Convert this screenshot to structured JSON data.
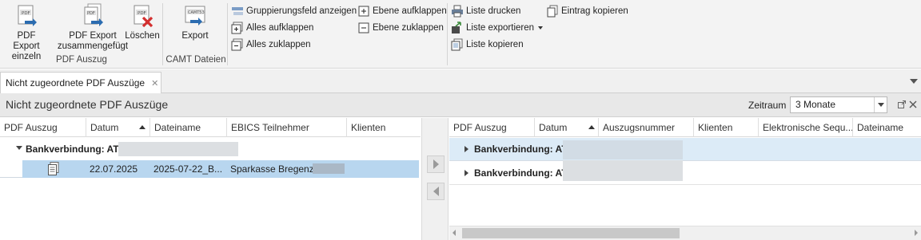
{
  "ribbon": {
    "pdf_export_einzeln": "PDF Export\neinzeln",
    "pdf_export_einzeln_l1": "PDF Export",
    "pdf_export_einzeln_l2": "einzeln",
    "pdf_export_zus_l1": "PDF Export",
    "pdf_export_zus_l2": "zusammengefügt",
    "loeschen": "Löschen",
    "group_pdf": "PDF Auszug",
    "export": "Export",
    "group_camt": "CAMT Dateien",
    "camt_icon_text": "CAMT53",
    "pdf_icon_text": "PDF",
    "gruppierungsfeld": "Gruppierungsfeld anzeigen",
    "alles_aufklappen": "Alles aufklappen",
    "alles_zuklappen": "Alles zuklappen",
    "ebene_aufklappen": "Ebene aufklappen",
    "ebene_zuklappen": "Ebene zuklappen",
    "liste_drucken": "Liste drucken",
    "liste_exportieren": "Liste exportieren",
    "liste_kopieren": "Liste kopieren",
    "eintrag_kopieren": "Eintrag kopieren"
  },
  "tab": {
    "label": "Nicht zugeordnete PDF Auszüge",
    "close": "✕"
  },
  "page": {
    "title": "Nicht zugeordnete PDF Auszüge",
    "zeitraum_label": "Zeitraum",
    "zeitraum_value": "3 Monate"
  },
  "left_grid": {
    "columns": [
      "PDF Auszug",
      "Datum",
      "Dateiname",
      "EBICS Teilnehmer",
      "Klienten"
    ],
    "group_label": "Bankverbindung: AT",
    "row": {
      "datum": "22.07.2025",
      "dateiname": "2025-07-22_B...",
      "ebics": "Sparkasse Bregenz,"
    }
  },
  "right_grid": {
    "columns": [
      "PDF Auszug",
      "Datum",
      "Auszugsnummer",
      "Klienten",
      "Elektronische Sequ...",
      "Dateiname"
    ],
    "groups": [
      "Bankverbindung: AT",
      "Bankverbindung: AT"
    ]
  },
  "colors": {
    "selection": "#b8d6ef",
    "group_highlight": "#dcebf7",
    "accent": "#2b6cb0",
    "delete_red": "#d32f2f"
  }
}
